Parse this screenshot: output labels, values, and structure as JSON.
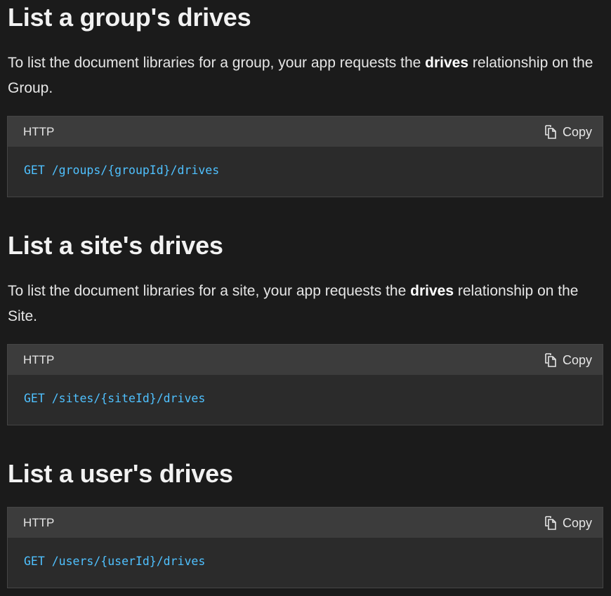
{
  "sections": [
    {
      "heading": "List a group's drives",
      "desc_before": "To list the document libraries for a group, your app requests the ",
      "desc_bold": "drives",
      "desc_after": " relationship on the Group.",
      "code": {
        "lang": "HTTP",
        "copy_label": "Copy",
        "line": "GET /groups/{groupId}/drives"
      }
    },
    {
      "heading": "List a site's drives",
      "desc_before": "To list the document libraries for a site, your app requests the ",
      "desc_bold": "drives",
      "desc_after": " relationship on the Site.",
      "code": {
        "lang": "HTTP",
        "copy_label": "Copy",
        "line": "GET /sites/{siteId}/drives"
      }
    },
    {
      "heading": "List a user's drives",
      "code": {
        "lang": "HTTP",
        "copy_label": "Copy",
        "line": "GET /users/{userId}/drives"
      }
    }
  ],
  "icons": {
    "copy": "copy-icon"
  },
  "colors": {
    "background": "#1b1b1b",
    "code_header": "#3c3c3c",
    "code_body": "#2b2b2b",
    "code_text": "#4fc1ff",
    "text": "#e6e6e6"
  }
}
